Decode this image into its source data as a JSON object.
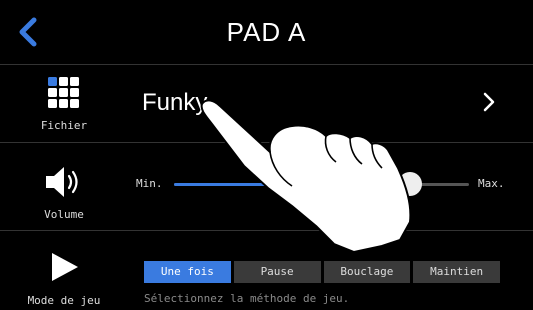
{
  "header": {
    "title": "PAD A",
    "back_icon": "chevron-left-icon",
    "accent": "#3a7be0"
  },
  "file": {
    "label": "Fichier",
    "name": "Funky",
    "icon": "grid-icon"
  },
  "volume": {
    "label": "Volume",
    "min_label": "Min.",
    "max_label": "Max.",
    "level": 0.8,
    "icon": "speaker-icon"
  },
  "play_mode": {
    "label": "Mode de jeu",
    "icon": "play-icon",
    "options": [
      "Une fois",
      "Pause",
      "Bouclage",
      "Maintien"
    ],
    "selected": "Une fois",
    "hint": "Sélectionnez la méthode de jeu."
  }
}
